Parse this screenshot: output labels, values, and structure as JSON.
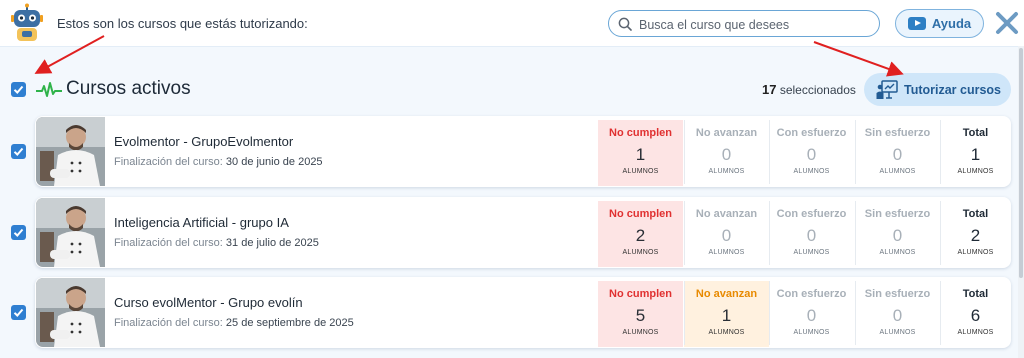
{
  "header": {
    "intro_text": "Estos son los cursos que estás tutorizando:",
    "search_placeholder": "Busca el curso que desees",
    "help_label": "Ayuda"
  },
  "section": {
    "title": "Cursos activos",
    "selected_count": "17",
    "selected_label": "seleccionados",
    "tutor_button_label": "Tutorizar cursos"
  },
  "stat_labels": [
    "No cumplen",
    "No avanzan",
    "Con esfuerzo",
    "Sin esfuerzo",
    "Total"
  ],
  "unit_label": "ALUMNOS",
  "date_prefix": "Finalización del curso:",
  "colors": {
    "accent": "#2f7fd1",
    "no_cumplen_bg": "#fde4e4",
    "no_cumplen_text": "#e03131",
    "no_avanzan_active_bg": "#fff1df",
    "no_avanzan_active_text": "#e88a00",
    "muted_text": "#a8b0b8",
    "pulse_icon": "#2fb34a",
    "annotation_arrow": "#e02020"
  },
  "courses": [
    {
      "name": "Evolmentor - GrupoEvolmentor",
      "end_date": "30 de junio de 2025",
      "checked": true,
      "stats": [
        "1",
        "0",
        "0",
        "0",
        "1"
      ]
    },
    {
      "name": "Inteligencia Artificial - grupo IA",
      "end_date": "31 de julio de 2025",
      "checked": true,
      "stats": [
        "2",
        "0",
        "0",
        "0",
        "2"
      ]
    },
    {
      "name": "Curso evolMentor - Grupo evolín",
      "end_date": "25 de septiembre de 2025",
      "checked": true,
      "stats": [
        "5",
        "1",
        "0",
        "0",
        "6"
      ]
    }
  ]
}
